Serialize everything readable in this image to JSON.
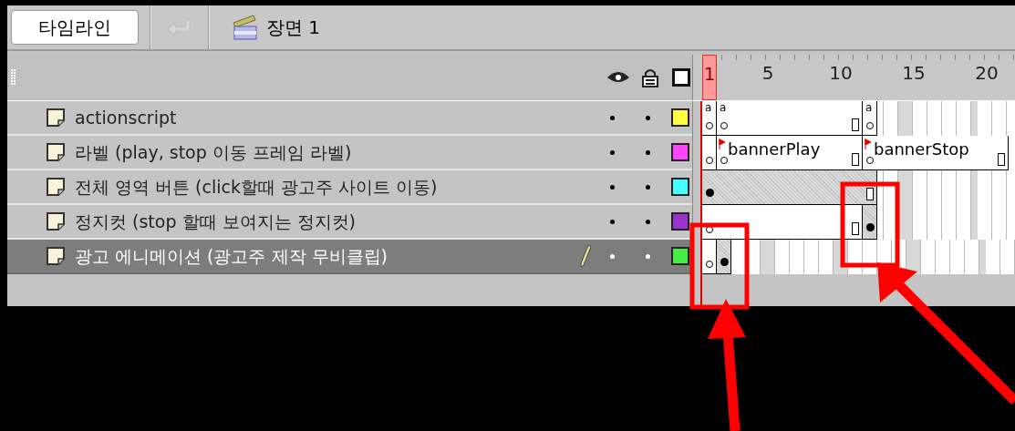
{
  "toolbar": {
    "timeline_button": "타임라인",
    "scene": "장면 1"
  },
  "ruler": [
    {
      "label": "1",
      "selected": true
    },
    {
      "label": "5",
      "selected": false
    },
    {
      "label": "10",
      "selected": false
    },
    {
      "label": "15",
      "selected": false
    },
    {
      "label": "20",
      "selected": false
    }
  ],
  "layers": [
    {
      "name": "actionscript",
      "color": "#ffff44",
      "selected": false,
      "frames": [
        {
          "kind": "blank_keyframe",
          "script": "a"
        },
        {
          "kind": "blank_keyframe",
          "script": "a"
        },
        {
          "kind": "continued"
        },
        {
          "kind": "continued"
        },
        {
          "kind": "continued"
        },
        {
          "kind": "continued"
        },
        {
          "kind": "continued"
        },
        {
          "kind": "continued"
        },
        {
          "kind": "continued"
        },
        {
          "kind": "continued"
        },
        {
          "kind": "end"
        },
        {
          "kind": "blank_keyframe",
          "script": "a"
        }
      ]
    },
    {
      "name": "라벨 (play, stop 이동 프레임 라벨)",
      "color": "#ff44ff",
      "selected": false,
      "frames": [
        {
          "kind": "blank_keyframe"
        },
        {
          "kind": "blank_keyframe",
          "label": "bannerPlay"
        },
        {
          "kind": "continued"
        },
        {
          "kind": "continued"
        },
        {
          "kind": "continued"
        },
        {
          "kind": "continued"
        },
        {
          "kind": "continued"
        },
        {
          "kind": "continued"
        },
        {
          "kind": "continued"
        },
        {
          "kind": "continued"
        },
        {
          "kind": "end"
        },
        {
          "kind": "blank_keyframe",
          "label": "bannerStop"
        },
        {
          "kind": "continued"
        },
        {
          "kind": "continued"
        },
        {
          "kind": "continued"
        },
        {
          "kind": "continued"
        },
        {
          "kind": "continued"
        },
        {
          "kind": "continued"
        },
        {
          "kind": "continued"
        },
        {
          "kind": "continued"
        },
        {
          "kind": "end"
        }
      ]
    },
    {
      "name": "전체 영역 버튼 (click할때 광고주 사이트 이동)",
      "color": "#44ffff",
      "selected": false,
      "frames": [
        {
          "kind": "keyframe"
        },
        {
          "kind": "continued"
        },
        {
          "kind": "continued"
        },
        {
          "kind": "continued"
        },
        {
          "kind": "continued"
        },
        {
          "kind": "continued"
        },
        {
          "kind": "continued"
        },
        {
          "kind": "continued"
        },
        {
          "kind": "continued"
        },
        {
          "kind": "continued"
        },
        {
          "kind": "continued"
        },
        {
          "kind": "end"
        }
      ]
    },
    {
      "name": "정지컷 (stop 할때 보여지는 정지컷)",
      "color": "#9933cc",
      "selected": false,
      "frames": [
        {
          "kind": "blank_keyframe"
        },
        {
          "kind": "continued"
        },
        {
          "kind": "continued"
        },
        {
          "kind": "continued"
        },
        {
          "kind": "continued"
        },
        {
          "kind": "continued"
        },
        {
          "kind": "continued"
        },
        {
          "kind": "continued"
        },
        {
          "kind": "continued"
        },
        {
          "kind": "continued"
        },
        {
          "kind": "end"
        },
        {
          "kind": "keyframe"
        }
      ]
    },
    {
      "name": "광고 에니메이션 (광고주 제작 무비클립)",
      "color": "#44ee44",
      "selected": true,
      "frames": [
        {
          "kind": "blank_keyframe"
        },
        {
          "kind": "keyframe"
        }
      ]
    }
  ]
}
